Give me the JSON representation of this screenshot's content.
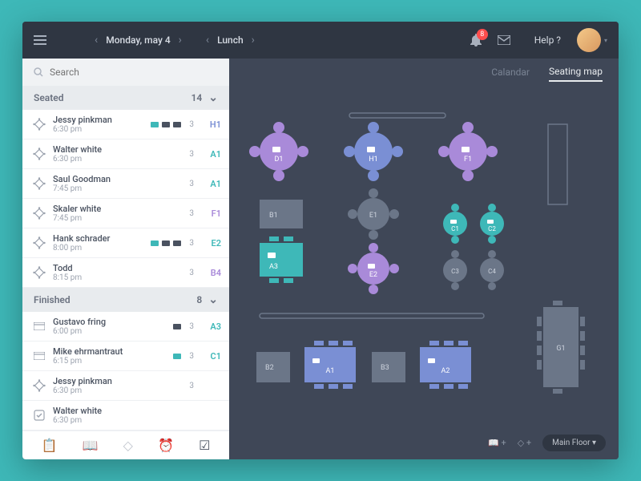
{
  "header": {
    "date": "Monday, may 4",
    "meal": "Lunch",
    "notification_count": "8",
    "help_label": "Help ?"
  },
  "search": {
    "placeholder": "Search"
  },
  "tabs": {
    "calendar": "Calandar",
    "seating_map": "Seating map"
  },
  "sections": {
    "seated": {
      "title": "Seated",
      "count": "14"
    },
    "finished": {
      "title": "Finished",
      "count": "8"
    }
  },
  "seated": [
    {
      "name": "Jessy pinkman",
      "time": "6:30 pm",
      "party": "3",
      "table": "H1",
      "cls": "tbl-H"
    },
    {
      "name": "Walter white",
      "time": "6:30 pm",
      "party": "3",
      "table": "A1",
      "cls": "tbl-A"
    },
    {
      "name": "Saul Goodman",
      "time": "7:45 pm",
      "party": "3",
      "table": "A1",
      "cls": "tbl-A"
    },
    {
      "name": "Skaler white",
      "time": "7:45 pm",
      "party": "3",
      "table": "F1",
      "cls": "tbl-F"
    },
    {
      "name": "Hank schrader",
      "time": "8:00 pm",
      "party": "3",
      "table": "E2",
      "cls": "tbl-A"
    },
    {
      "name": "Todd",
      "time": "8:15 pm",
      "party": "3",
      "table": "B4",
      "cls": "tbl-F"
    }
  ],
  "finished": [
    {
      "name": "Gustavo fring",
      "time": "6:00 pm",
      "party": "3",
      "table": "A3",
      "cls": "tbl-A"
    },
    {
      "name": "Mike ehrmantraut",
      "time": "6:15 pm",
      "party": "3",
      "table": "C1",
      "cls": "tbl-A"
    },
    {
      "name": "Jessy pinkman",
      "time": "6:30 pm",
      "party": "3",
      "table": "",
      "cls": ""
    },
    {
      "name": "Walter white",
      "time": "6:30 pm",
      "party": "",
      "table": "",
      "cls": ""
    }
  ],
  "floor": {
    "selector": "Main Floor"
  },
  "tables": {
    "D1": "D1",
    "H1": "H1",
    "F1": "F1",
    "B1": "B1",
    "E1": "E1",
    "C1": "C1",
    "C2": "C2",
    "A3": "A3",
    "E2": "E2",
    "C3": "C3",
    "C4": "C4",
    "B2": "B2",
    "A1": "A1",
    "B3": "B3",
    "A2": "A2",
    "G1": "G1"
  }
}
